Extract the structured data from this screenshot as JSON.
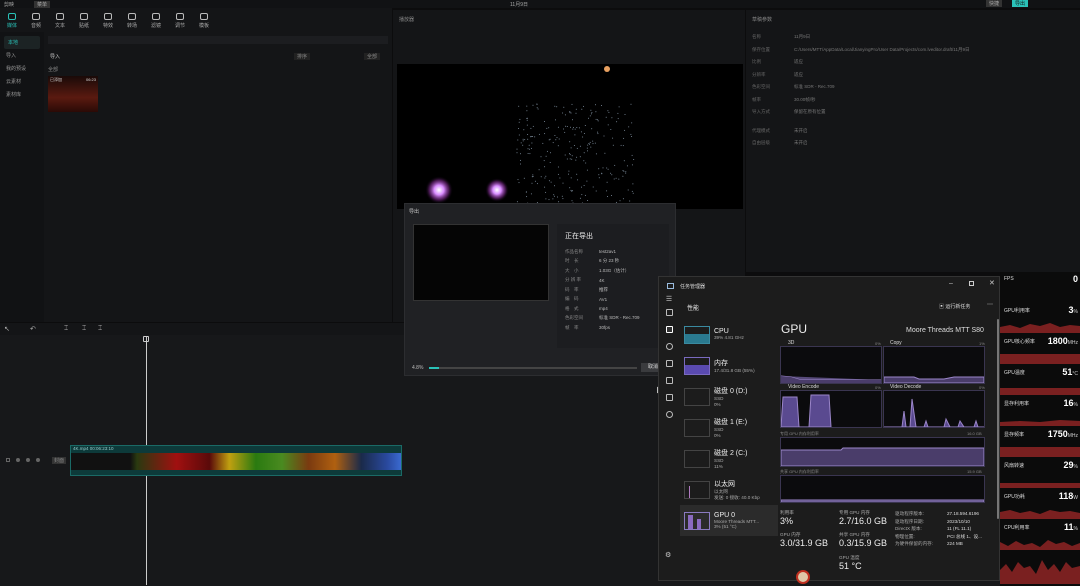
{
  "editor": {
    "app_name": "剪映",
    "menu": "菜单",
    "project_date": "11月9日",
    "topbar_right": [
      "快捷",
      "导出"
    ],
    "tools": [
      {
        "label": "媒体",
        "icon": "media-icon"
      },
      {
        "label": "音频",
        "icon": "audio-icon"
      },
      {
        "label": "文本",
        "icon": "text-icon"
      },
      {
        "label": "贴纸",
        "icon": "sticker-icon"
      },
      {
        "label": "特效",
        "icon": "effects-icon"
      },
      {
        "label": "转场",
        "icon": "transition-icon"
      },
      {
        "label": "滤镜",
        "icon": "filter-icon"
      },
      {
        "label": "调节",
        "icon": "adjust-icon"
      },
      {
        "label": "模板",
        "icon": "template-icon"
      }
    ],
    "sidebar": [
      "本地",
      "导入",
      "我的预设",
      "云素材",
      "素材库"
    ],
    "media_import": "导入",
    "media_sort": "排序",
    "media_all": "全部",
    "media_tab": "全部",
    "clip_badge": "已添加",
    "clip_duration": "06:23",
    "player_title": "播放器",
    "props_title": "草稿参数",
    "props_rows": [
      {
        "k": "名称",
        "v": "11月9日"
      },
      {
        "k": "保存位置",
        "v": "C:/Users/MTT/AppData/Local/JianyingPro/User Data/Projects/com.lveditor.draft/11月9日"
      },
      {
        "k": "比例",
        "v": "适应"
      },
      {
        "k": "分辨率",
        "v": "适应"
      },
      {
        "k": "色彩空间",
        "v": "标准 SDR - Rec.709"
      },
      {
        "k": "帧率",
        "v": "30.00帧/秒"
      },
      {
        "k": "导入方式",
        "v": "保留在原有位置"
      },
      {
        "k": "代理模式",
        "v": "未开启"
      },
      {
        "k": "自由层级",
        "v": "未开启"
      }
    ],
    "track_label": "封面",
    "clip_name": "4K.mp4  00:06:23:10"
  },
  "export": {
    "title": "导出",
    "heading": "正在导出",
    "rows": [
      {
        "k": "作品名称",
        "v": "test2av1"
      },
      {
        "k": "时　长",
        "v": "6 分 23 秒"
      },
      {
        "k": "大　小",
        "v": "1.03G（估计）"
      },
      {
        "k": "分 辨 率",
        "v": "4K"
      },
      {
        "k": "码　率",
        "v": "推荐"
      },
      {
        "k": "编　码",
        "v": "AV1"
      },
      {
        "k": "格　式",
        "v": "mp4"
      },
      {
        "k": "色彩空间",
        "v": "标准 SDR - Rec.709"
      },
      {
        "k": "帧　率",
        "v": "30fps"
      }
    ],
    "progress_text": "4.8%",
    "progress": 0.048,
    "cancel": "取消"
  },
  "taskmgr": {
    "title": "任务管理器",
    "section": "性能",
    "run_task": "运行新任务",
    "resources": [
      {
        "name": "CPU",
        "l1": "39%  4.81 GHz",
        "l2": ""
      },
      {
        "name": "内存",
        "l1": "17.4/31.8 GB (55%)",
        "l2": ""
      },
      {
        "name": "磁盘 0 (D:)",
        "l1": "SSD",
        "l2": "0%"
      },
      {
        "name": "磁盘 1 (E:)",
        "l1": "SSD",
        "l2": "0%"
      },
      {
        "name": "磁盘 2 (C:)",
        "l1": "SSD",
        "l2": "11%"
      },
      {
        "name": "以太网",
        "l1": "以太网",
        "l2": "发送: 0  接收: 40.0 Kbp"
      },
      {
        "name": "GPU 0",
        "l1": "Moore Threads MTT...",
        "l2": "3% (51 °C)"
      }
    ],
    "gpu_title": "GPU",
    "gpu_model": "Moore Threads MTT S80",
    "engines": [
      {
        "name": "3D",
        "pct": "0%"
      },
      {
        "name": "Copy",
        "pct": "1%"
      },
      {
        "name": "Video Encode",
        "pct": "0%"
      },
      {
        "name": "Video Decode",
        "pct": "0%"
      }
    ],
    "dedicated_label": "专用 GPU 内存利用率",
    "dedicated_max": "16.0 GB",
    "shared_label": "共享 GPU 内存利用率",
    "shared_max": "15.9 GB",
    "stats": [
      {
        "k": "利用率",
        "v": "3%"
      },
      {
        "k": "专用 GPU 内存",
        "v": "2.7/16.0 GB"
      },
      {
        "k": "GPU 内存",
        "v": "3.0/31.9 GB"
      },
      {
        "k": "共享 GPU 内存",
        "v": "0.3/15.9 GB"
      },
      {
        "k": "GPU 温度",
        "v": "51 °C"
      }
    ],
    "details": [
      {
        "k": "驱动程序版本:",
        "v": "27.18.594.6196"
      },
      {
        "k": "驱动程序日期:",
        "v": "2023/10/10"
      },
      {
        "k": "DirectX 版本:",
        "v": "11 (FL 11.1)"
      },
      {
        "k": "物理位置:",
        "v": "PCI 总线 1、设..."
      },
      {
        "k": "为硬件保留的内存:",
        "v": "224 MB"
      }
    ]
  },
  "overlay": [
    {
      "name": "FPS",
      "value": "0",
      "unit": ""
    },
    {
      "name": "GPU利用率",
      "value": "3",
      "unit": "%"
    },
    {
      "name": "GPU核心频率",
      "value": "1800",
      "unit": "MHz"
    },
    {
      "name": "GPU温度",
      "value": "51",
      "unit": "°C"
    },
    {
      "name": "显存利用率",
      "value": "16",
      "unit": "%"
    },
    {
      "name": "显存频率",
      "value": "1750",
      "unit": "MHz"
    },
    {
      "name": "风扇转速",
      "value": "29",
      "unit": "%"
    },
    {
      "name": "GPU功耗",
      "value": "118",
      "unit": "W"
    },
    {
      "name": "CPU利用率",
      "value": "11",
      "unit": "%"
    }
  ],
  "colors": {
    "accent": "#2ac2b8",
    "graph": "#9b86c9",
    "overlay_graph": "#c0392b"
  }
}
